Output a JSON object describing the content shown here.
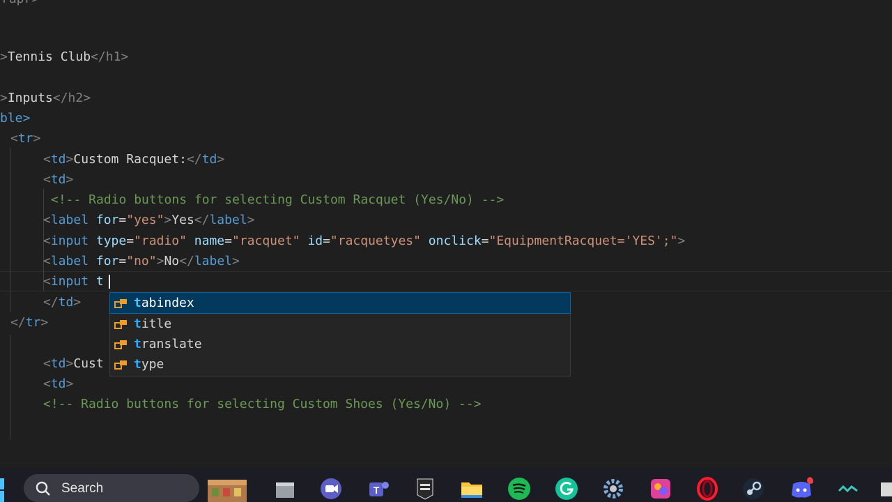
{
  "editor": {
    "lines": {
      "l0": "rapr>",
      "l2_open": ">",
      "l2_text": "Tennis Club",
      "l2_close": "</h1>",
      "l4_open": ">",
      "l4_text": "Inputs",
      "l4_close": "</h2>",
      "l5": "ble>",
      "l6_lt": "<",
      "l6_tn": "tr",
      "l6_gt": ">",
      "l7_text": "Custom Racquet:",
      "l9_comment": "<!-- Radio buttons for selecting Custom Racquet (Yes/No) -->",
      "l10_for_val": "\"yes\"",
      "l10_text": "Yes",
      "l11_type_val": "\"radio\"",
      "l11_name_val": "\"racquet\"",
      "l11_id_val": "\"racquetyes\"",
      "l11_onclick_val": "\"EquipmentRacquet='YES';\"",
      "l12_for_val": "\"no\"",
      "l12_text": "No",
      "l13_typed": "t",
      "l17_text": "Cust",
      "l19_comment": "<!-- Radio buttons for selecting Custom Shoes (Yes/No) -->"
    },
    "tokens": {
      "td": "td",
      "label": "label",
      "input": "input",
      "for": "for",
      "type": "type",
      "name": "name",
      "id": "id",
      "onclick": "onclick",
      "tr": "tr"
    }
  },
  "suggest": {
    "items": [
      {
        "match": "t",
        "rest": "abindex"
      },
      {
        "match": "t",
        "rest": "itle"
      },
      {
        "match": "t",
        "rest": "ranslate"
      },
      {
        "match": "t",
        "rest": "ype"
      }
    ],
    "selected_index": 0
  },
  "taskbar": {
    "search_label": "Search",
    "icons": [
      "widgets-icon",
      "file-explorer-window-icon",
      "video-chat-icon",
      "teams-icon",
      "epic-games-icon",
      "folder-icon",
      "spotify-icon",
      "grammarly-icon",
      "settings-gear-icon",
      "paint-app-icon",
      "opera-icon",
      "steam-icon",
      "discord-icon",
      "wave-app-icon"
    ],
    "colors": {
      "accent": "#04395e",
      "spotify": "#1db954",
      "grammarly": "#15c39a",
      "opera": "#ff1b2d",
      "discord": "#5865f2",
      "folder": "#f8c43a"
    }
  }
}
